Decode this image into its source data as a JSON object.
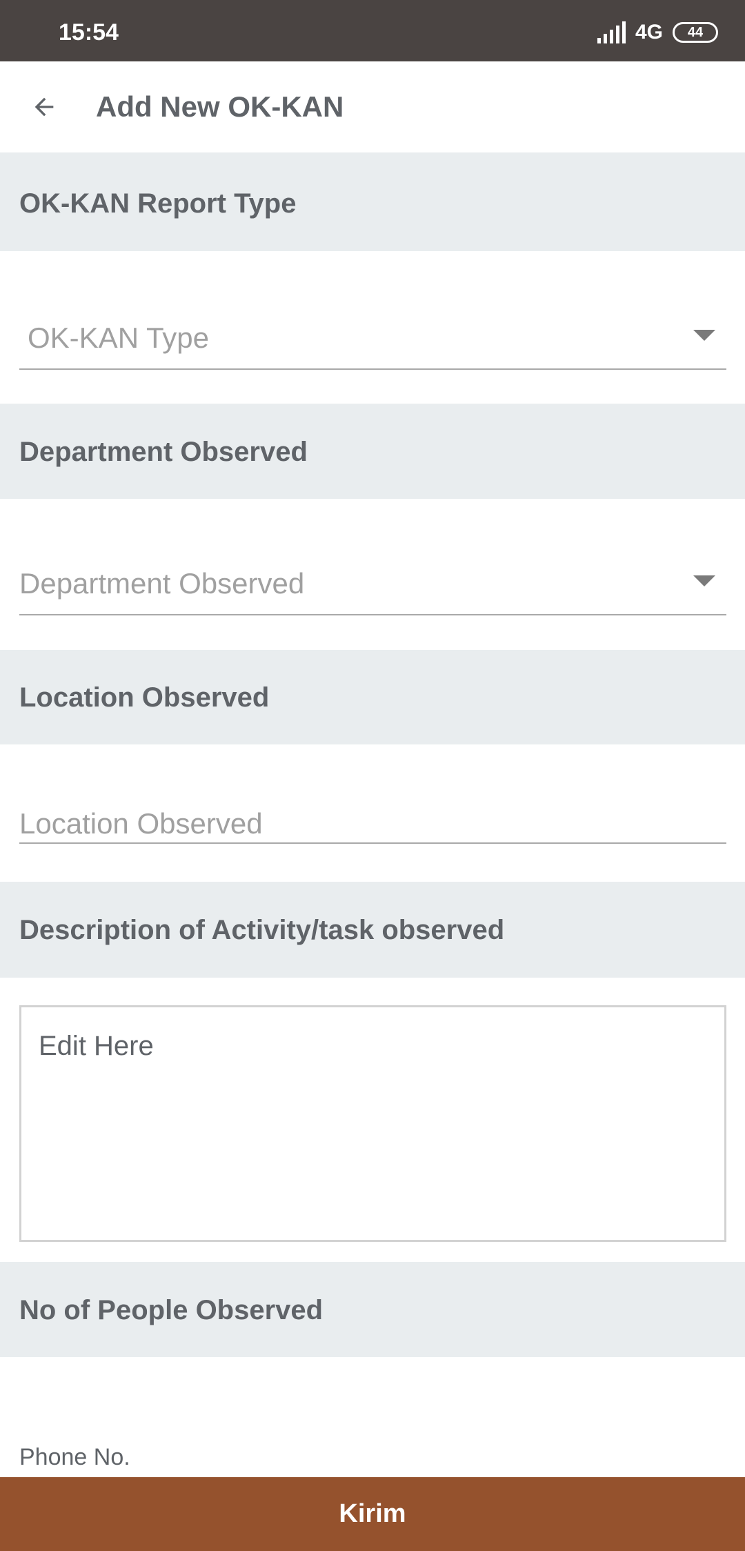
{
  "status_bar": {
    "time": "15:54",
    "network": "4G",
    "battery": "44"
  },
  "app_bar": {
    "title": "Add New OK-KAN",
    "back_icon": "arrow-left-icon"
  },
  "sections": {
    "report_type": {
      "header": "OK-KAN Report Type",
      "placeholder": "OK-KAN Type"
    },
    "department": {
      "header": "Department Observed",
      "placeholder": "Department Observed"
    },
    "location": {
      "header": "Location Observed",
      "placeholder": "Location Observed"
    },
    "description": {
      "header": "Description of Activity/task observed",
      "placeholder": "Edit Here"
    },
    "people": {
      "header": "No of People Observed",
      "phone_label": "Phone No."
    }
  },
  "submit": {
    "label": "Kirim"
  },
  "colors": {
    "status_bar": "#4a4442",
    "section_header_bg": "#e9edef",
    "submit_bg": "#95522d",
    "text": "#5f6368"
  }
}
